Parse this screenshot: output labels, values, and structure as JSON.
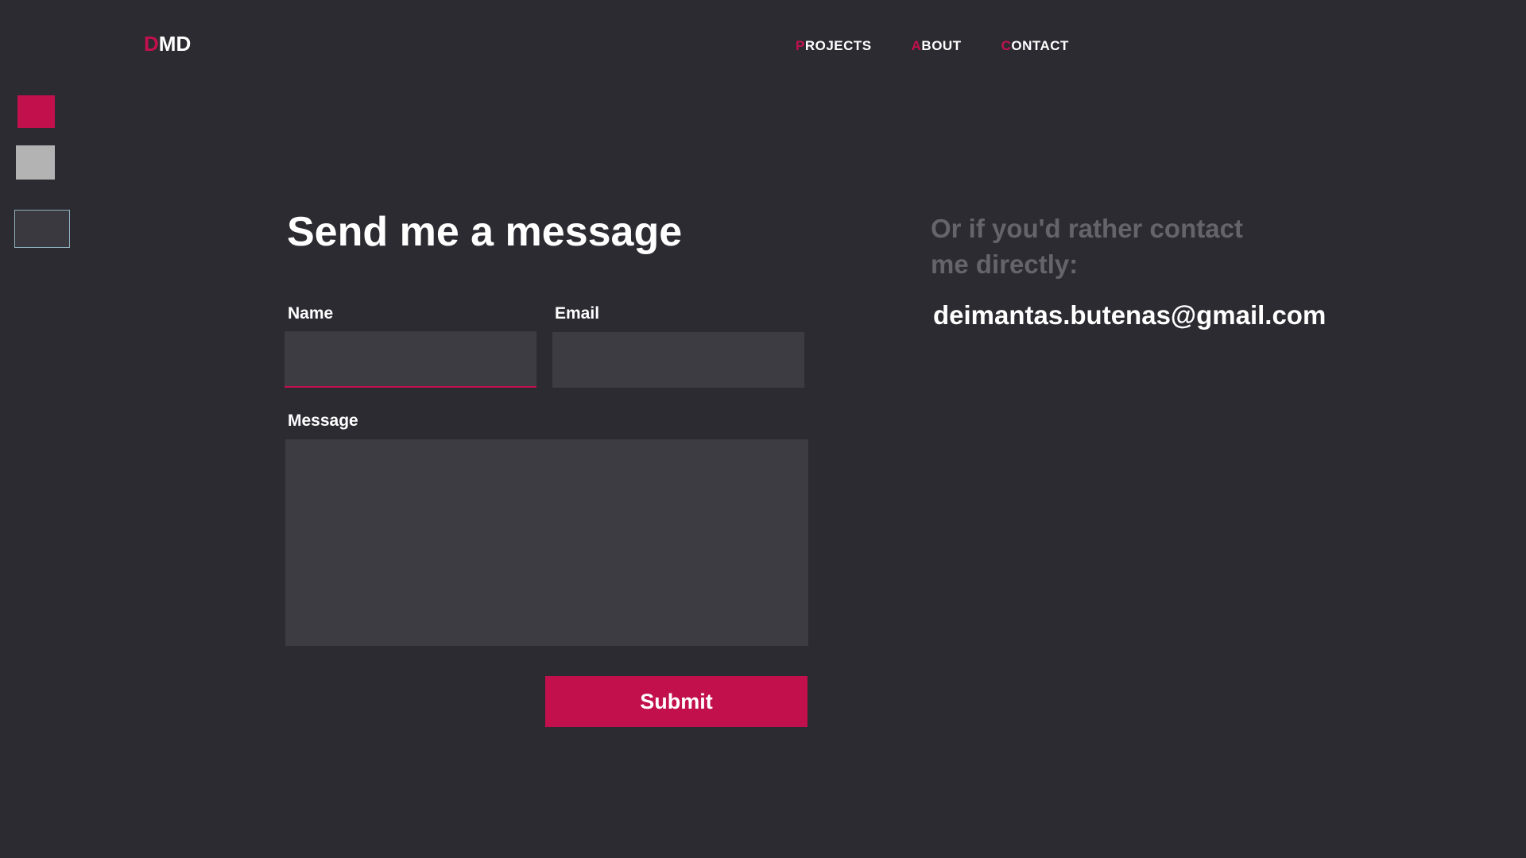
{
  "logo": {
    "first": "D",
    "rest": "MD"
  },
  "nav": [
    {
      "first": "P",
      "rest": "ROJECTS"
    },
    {
      "first": "A",
      "rest": "BOUT"
    },
    {
      "first": "C",
      "rest": "ONTACT"
    }
  ],
  "theme_swatches": [
    {
      "name": "accent",
      "color": "#c2104d"
    },
    {
      "name": "light-gray",
      "color": "#b3b3b3"
    },
    {
      "name": "dark",
      "color": "#3a3940"
    }
  ],
  "form": {
    "heading": "Send me a message",
    "name_label": "Name",
    "name_value": "",
    "email_label": "Email",
    "email_value": "",
    "message_label": "Message",
    "message_value": "",
    "submit_label": "Submit"
  },
  "direct": {
    "heading": "Or if you'd rather contact me directly:",
    "email": "deimantas.butenas@gmail.com"
  },
  "colors": {
    "background": "#2c2b31",
    "accent": "#c2104d",
    "input_bg": "#3d3c43",
    "muted_text": "#65646b"
  }
}
